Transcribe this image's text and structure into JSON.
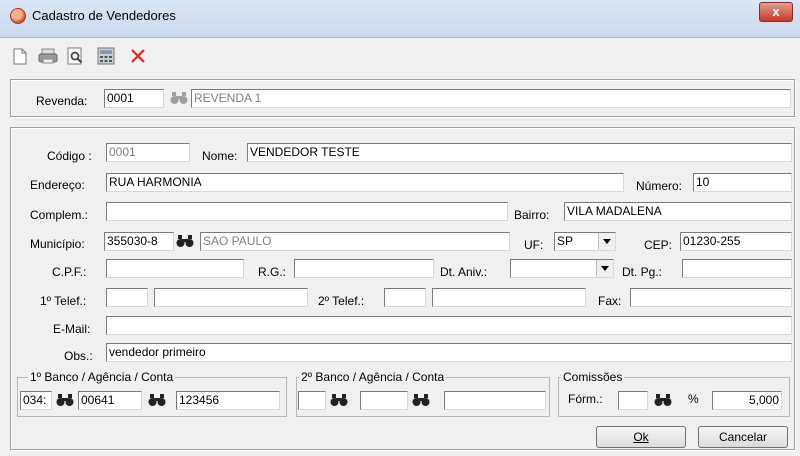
{
  "window": {
    "title": "Cadastro de Vendedores",
    "close_glyph": "x"
  },
  "toolbar": [
    "new-icon",
    "print-icon",
    "preview-icon",
    "calculator-icon",
    "delete-icon"
  ],
  "revenda": {
    "label": "Revenda:",
    "code": "0001",
    "name": "REVENDA 1"
  },
  "form": {
    "codigo_label": "Código :",
    "codigo": "0001",
    "nome_label": "Nome:",
    "nome": "VENDEDOR TESTE",
    "endereco_label": "Endereço:",
    "endereco": "RUA HARMONIA",
    "numero_label": "Número:",
    "numero": "10",
    "complem_label": "Complem.:",
    "complem": "",
    "bairro_label": "Bairro:",
    "bairro": "VILA MADALENA",
    "municipio_label": "Município:",
    "municipio_code": "355030-8",
    "municipio_name": "SAO PAULO",
    "uf_label": "UF:",
    "uf": "SP",
    "cep_label": "CEP:",
    "cep": "01230-255",
    "cpf_label": "C.P.F.:",
    "cpf": "",
    "rg_label": "R.G.:",
    "rg": "",
    "dtaniv_label": "Dt. Aniv.:",
    "dtaniv": "",
    "dtpg_label": "Dt. Pg.:",
    "dtpg": "",
    "telef1_label": "1º Telef.:",
    "telef1_ddd": "",
    "telef1": "",
    "telef2_label": "2º Telef.:",
    "telef2_ddd": "",
    "telef2": "",
    "fax_label": "Fax:",
    "fax": "",
    "email_label": "E-Mail:",
    "email": "",
    "obs_label": "Obs.:",
    "obs": "vendedor primeiro"
  },
  "banco1": {
    "title": "1º Banco / Agência / Conta",
    "banco": "034:",
    "agencia": "00641",
    "conta": "123456"
  },
  "banco2": {
    "title": "2º Banco / Agência / Conta",
    "banco": "",
    "agencia": "",
    "conta": ""
  },
  "comissoes": {
    "title": "Comissões",
    "form_label": "Fórm.:",
    "form": "",
    "percent_label": "%",
    "percent": "5,000"
  },
  "buttons": {
    "ok": "Ok",
    "cancelar": "Cancelar"
  }
}
